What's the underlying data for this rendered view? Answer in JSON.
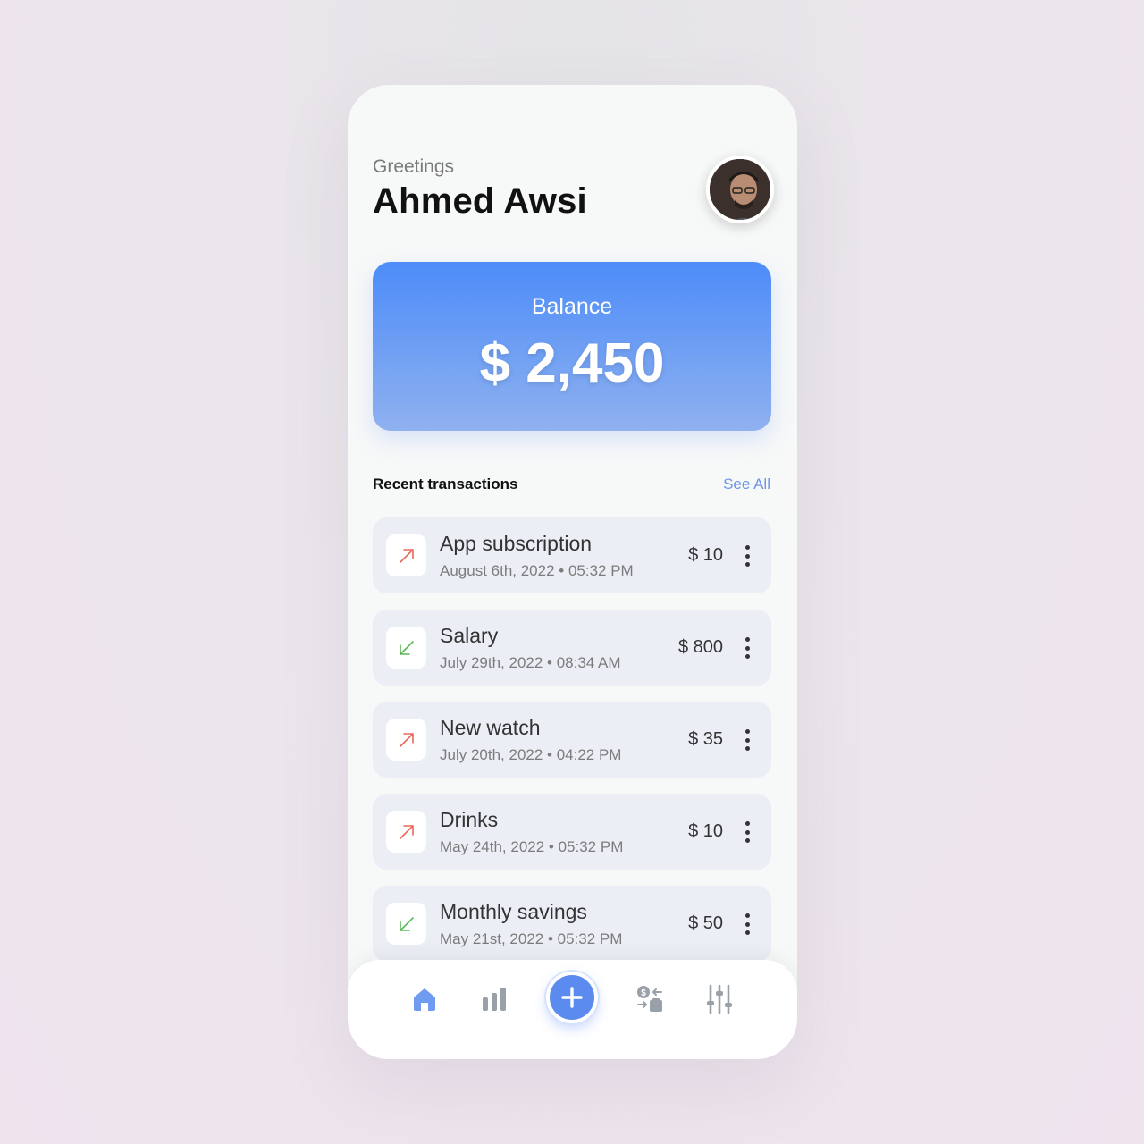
{
  "header": {
    "greeting": "Greetings",
    "user_name": "Ahmed Awsi"
  },
  "balance": {
    "label": "Balance",
    "amount": "$ 2,450"
  },
  "transactions_section": {
    "title": "Recent transactions",
    "see_all_label": "See All"
  },
  "transactions": [
    {
      "title": "App subscription",
      "date": "August 6th, 2022 • 05:32 PM",
      "amount": "$ 10",
      "direction": "outgoing",
      "icon": "arrow-up-right-icon"
    },
    {
      "title": "Salary",
      "date": "July 29th, 2022 • 08:34 AM",
      "amount": "$ 800",
      "direction": "incoming",
      "icon": "arrow-down-left-icon"
    },
    {
      "title": "New watch",
      "date": "July 20th, 2022 • 04:22 PM",
      "amount": "$ 35",
      "direction": "outgoing",
      "icon": "arrow-up-right-icon"
    },
    {
      "title": "Drinks",
      "date": "May 24th, 2022 • 05:32 PM",
      "amount": "$ 10",
      "direction": "outgoing",
      "icon": "arrow-up-right-icon"
    },
    {
      "title": "Monthly savings",
      "date": "May 21st, 2022 • 05:32 PM",
      "amount": "$ 50",
      "direction": "incoming",
      "icon": "arrow-down-left-icon"
    }
  ],
  "nav": {
    "items": [
      "home-icon",
      "stats-icon",
      "add-icon",
      "exchange-icon",
      "settings-sliders-icon"
    ],
    "active": "home-icon"
  },
  "colors": {
    "accent": "#5c8bf0",
    "outgoing": "#e8685a",
    "incoming": "#5cb85c",
    "balance_gradient_top": "#4d8cf9",
    "balance_gradient_bottom": "#8fb1ef"
  }
}
